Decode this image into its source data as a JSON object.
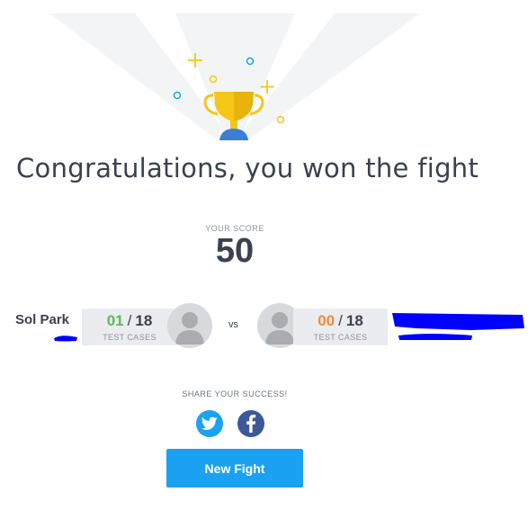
{
  "result": {
    "title": "Congratulations, you won the fight"
  },
  "score": {
    "label": "YOUR SCORE",
    "value": "50"
  },
  "fight": {
    "player": {
      "name": "Sol Park",
      "passed": "01",
      "separator": "/",
      "total": "18",
      "caption": "TEST CASES"
    },
    "vs_label": "vs",
    "opponent": {
      "passed": "00",
      "separator": "/",
      "total": "18",
      "caption": "TEST CASES"
    }
  },
  "share": {
    "label": "SHARE YOUR SUCCESS!",
    "icons": [
      "twitter-icon",
      "facebook-icon"
    ]
  },
  "actions": {
    "new_fight_label": "New Fight"
  },
  "colors": {
    "trophy": "#f5c518",
    "passed_good": "#5cb85c",
    "passed_bad": "#f0883d",
    "primary_button": "#1ba1f1",
    "twitter": "#1da1f2",
    "facebook": "#3b5998",
    "redaction": "#0000ff"
  }
}
